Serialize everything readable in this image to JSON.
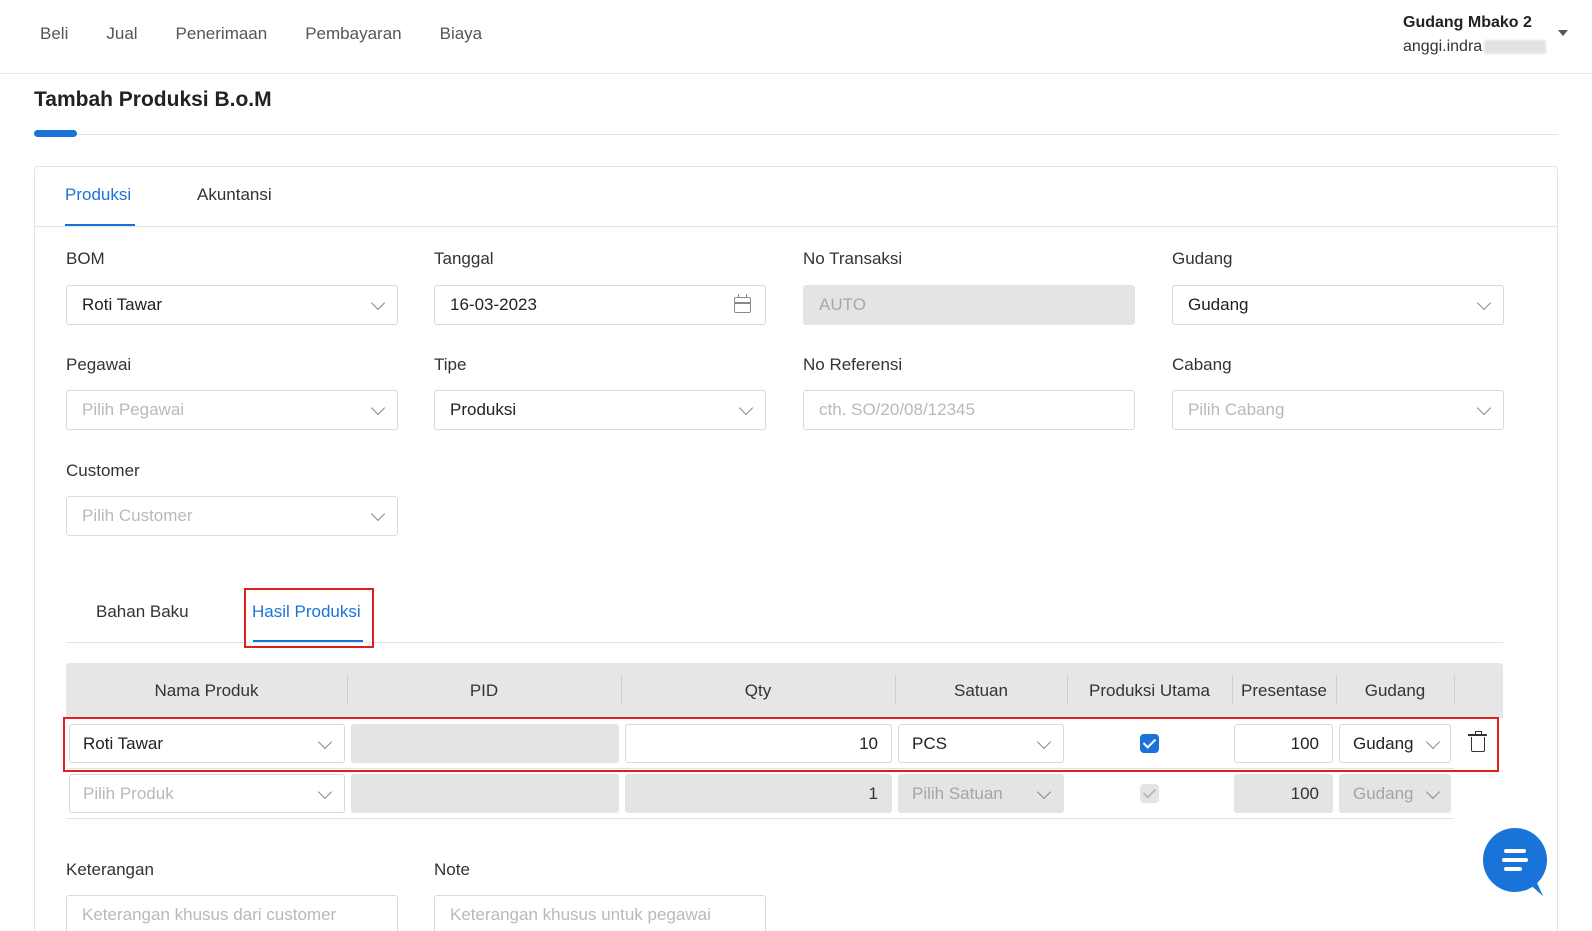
{
  "nav": {
    "items": [
      "Beli",
      "Jual",
      "Penerimaan",
      "Pembayaran",
      "Biaya"
    ]
  },
  "account": {
    "name": "Gudang Mbako 2",
    "email_visible": "anggi.indra"
  },
  "page": {
    "title": "Tambah Produksi B.o.M"
  },
  "main_tabs": [
    {
      "label": "Produksi",
      "active": true
    },
    {
      "label": "Akuntansi",
      "active": false
    }
  ],
  "form": {
    "bom": {
      "label": "BOM",
      "value": "Roti Tawar"
    },
    "tanggal": {
      "label": "Tanggal",
      "value": "16-03-2023"
    },
    "no_transaksi": {
      "label": "No Transaksi",
      "value": "AUTO"
    },
    "gudang": {
      "label": "Gudang",
      "value": "Gudang"
    },
    "pegawai": {
      "label": "Pegawai",
      "placeholder": "Pilih Pegawai"
    },
    "tipe": {
      "label": "Tipe",
      "value": "Produksi"
    },
    "no_referensi": {
      "label": "No Referensi",
      "placeholder": "cth. SO/20/08/12345"
    },
    "cabang": {
      "label": "Cabang",
      "placeholder": "Pilih Cabang"
    },
    "customer": {
      "label": "Customer",
      "placeholder": "Pilih Customer"
    },
    "keterangan": {
      "label": "Keterangan",
      "placeholder": "Keterangan khusus dari customer"
    },
    "note": {
      "label": "Note",
      "placeholder": "Keterangan khusus untuk pegawai"
    }
  },
  "sub_tabs": [
    {
      "label": "Bahan Baku",
      "active": false
    },
    {
      "label": "Hasil Produksi",
      "active": true
    }
  ],
  "table": {
    "columns": [
      "Nama Produk",
      "PID",
      "Qty",
      "Satuan",
      "Produksi Utama",
      "Presentase",
      "Gudang"
    ],
    "rows": [
      {
        "nama_produk": "Roti Tawar",
        "pid": "",
        "qty": "10",
        "satuan": "PCS",
        "produksi_utama": true,
        "presentase": "100",
        "gudang": "Gudang"
      },
      {
        "nama_produk": "Pilih Produk",
        "pid": "",
        "qty": "1",
        "satuan": "Pilih Satuan",
        "produksi_utama": true,
        "presentase": "100",
        "gudang": "Gudang"
      }
    ]
  },
  "colors": {
    "accent": "#1a73d9",
    "highlight": "#e0201b",
    "disabled_bg": "#e4e4e4"
  }
}
